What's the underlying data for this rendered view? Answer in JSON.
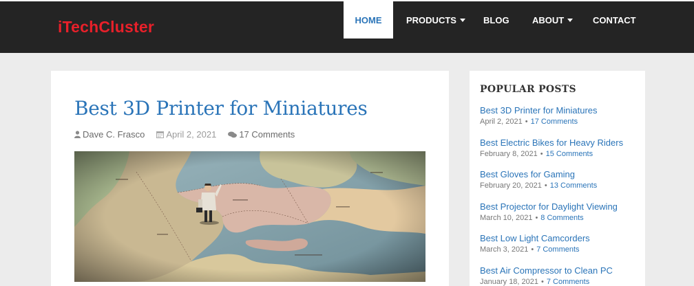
{
  "site": {
    "logo": "iTechCluster"
  },
  "nav": {
    "home": "HOME",
    "products": "PRODUCTS",
    "blog": "BLOG",
    "about": "ABOUT",
    "contact": "CONTACT"
  },
  "post": {
    "title": "Best 3D Printer for Miniatures",
    "author": "Dave C. Frasco",
    "date": "April 2, 2021",
    "comments": "17 Comments",
    "image_icon": "map-figurine-photo"
  },
  "sidebar": {
    "heading": "POPULAR POSTS",
    "items": [
      {
        "title": "Best 3D Printer for Miniatures",
        "date": "April 2, 2021",
        "comments": "17 Comments"
      },
      {
        "title": "Best Electric Bikes for Heavy Riders",
        "date": "February 8, 2021",
        "comments": "15 Comments"
      },
      {
        "title": "Best Gloves for Gaming",
        "date": "February 20, 2021",
        "comments": "13 Comments"
      },
      {
        "title": "Best Projector for Daylight Viewing",
        "date": "March 10, 2021",
        "comments": "8 Comments"
      },
      {
        "title": "Best Low Light Camcorders",
        "date": "March 3, 2021",
        "comments": "7 Comments"
      },
      {
        "title": "Best Air Compressor to Clean PC",
        "date": "January 18, 2021",
        "comments": "7 Comments"
      }
    ]
  },
  "colors": {
    "brand": "#e8202a",
    "link": "#2a74b8",
    "header": "#242424"
  }
}
